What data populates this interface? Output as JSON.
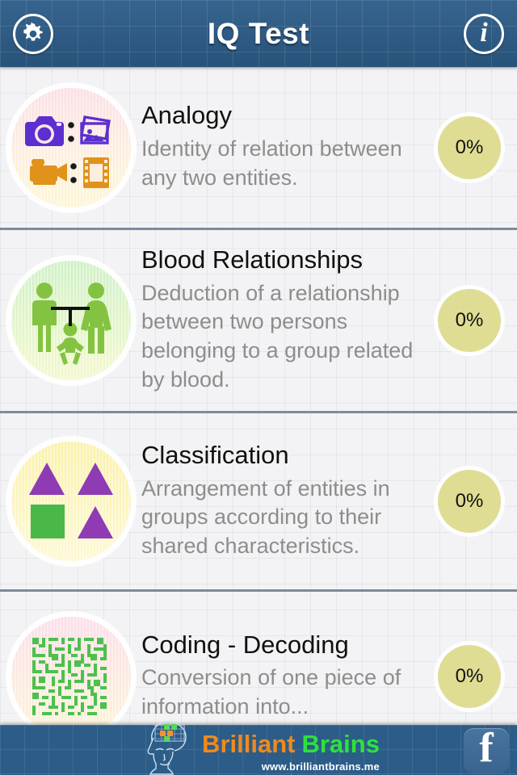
{
  "header": {
    "title": "IQ Test",
    "settings_icon": "gear-icon",
    "info_icon": "info-icon"
  },
  "topics": [
    {
      "title": "Analogy",
      "description": "Identity of relation between any two entities.",
      "score": "0%",
      "icon": "camera-photo-camcorder-film-icon",
      "circle_colors": [
        "#fbdfe6",
        "#fdf4d7"
      ],
      "icon_colors": [
        "#5b2fd0",
        "#e0921b"
      ]
    },
    {
      "title": "Blood Relationships",
      "description": "Deduction of a relationship between two persons belonging to a group related by blood.",
      "score": "0%",
      "icon": "family-icon",
      "circle_colors": [
        "#cdf0c7",
        "#f4f6cf"
      ],
      "icon_colors": [
        "#84c341",
        "#000000"
      ]
    },
    {
      "title": "Classification",
      "description": "Arrangement of entities in groups according to their shared characteristics.",
      "score": "0%",
      "icon": "shapes-triangles-square-icon",
      "circle_colors": [
        "#fbf3ae",
        "#fbf6c8"
      ],
      "icon_colors": [
        "#8e3bb4",
        "#49b849"
      ]
    },
    {
      "title": "Coding - Decoding",
      "description": "Conversion of one piece of information into...",
      "score": "0%",
      "icon": "qr-code-icon",
      "circle_colors": [
        "#fbdfe9",
        "#fdf3d8"
      ],
      "icon_colors": [
        "#4cc14c"
      ]
    }
  ],
  "footer": {
    "brand_first": "Brilliant",
    "brand_second": "Brains",
    "url": "www.brilliantbrains.me",
    "facebook_label": "f",
    "brand_icon": "brain-head-icon",
    "facebook_icon": "facebook-icon"
  },
  "colors": {
    "header_blue": "#2c5c88",
    "badge_yellow": "#dedd93",
    "divider": "#7f8a9b",
    "title_text": "#101010",
    "desc_text": "#8d8d8d",
    "brand_orange": "#f08a1c",
    "brand_green": "#2ee23c"
  }
}
